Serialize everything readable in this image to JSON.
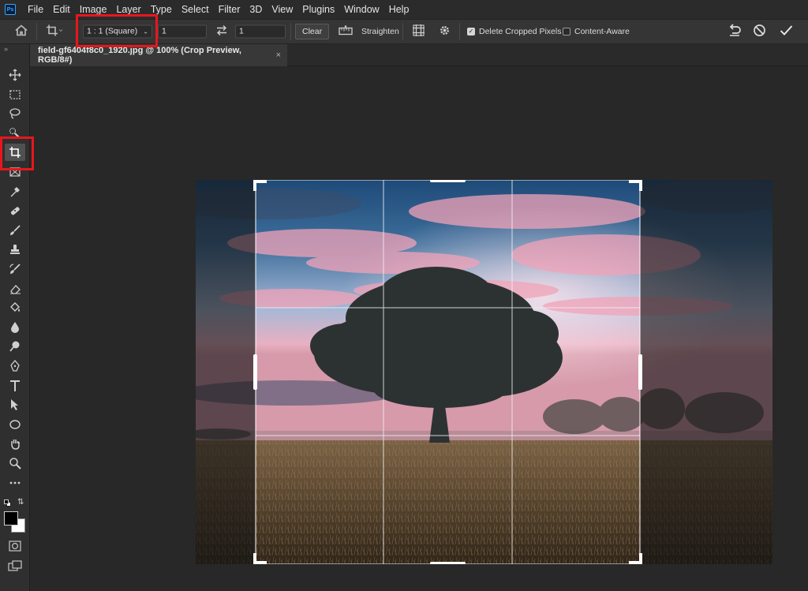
{
  "menubar": {
    "logo": "Ps",
    "items": [
      "File",
      "Edit",
      "Image",
      "Layer",
      "Type",
      "Select",
      "Filter",
      "3D",
      "View",
      "Plugins",
      "Window",
      "Help"
    ]
  },
  "options": {
    "ratio": "1 : 1 (Square)",
    "width": "1",
    "height": "1",
    "clear": "Clear",
    "straighten": "Straighten",
    "delete_cropped": "Delete Cropped Pixels",
    "delete_cropped_checked": true,
    "content_aware": "Content-Aware",
    "content_aware_checked": false
  },
  "document": {
    "tab_title": "field-gf6404f8c0_1920.jpg @ 100% (Crop Preview, RGB/8#)",
    "close_glyph": "×"
  },
  "colors": {
    "highlight": "#e8161c",
    "foreground": "#000000",
    "background": "#ffffff"
  },
  "tools": [
    "move-icon",
    "marquee-icon",
    "lasso-icon",
    "quick-select-icon",
    "crop-icon",
    "frame-icon",
    "eyedropper-icon",
    "healing-icon",
    "brush-icon",
    "stamp-icon",
    "history-brush-icon",
    "eraser-icon",
    "paint-bucket-icon",
    "blur-icon",
    "dodge-icon",
    "pen-icon",
    "type-icon",
    "path-select-icon",
    "ellipse-icon",
    "hand-icon",
    "zoom-icon",
    "more-tools-icon"
  ]
}
